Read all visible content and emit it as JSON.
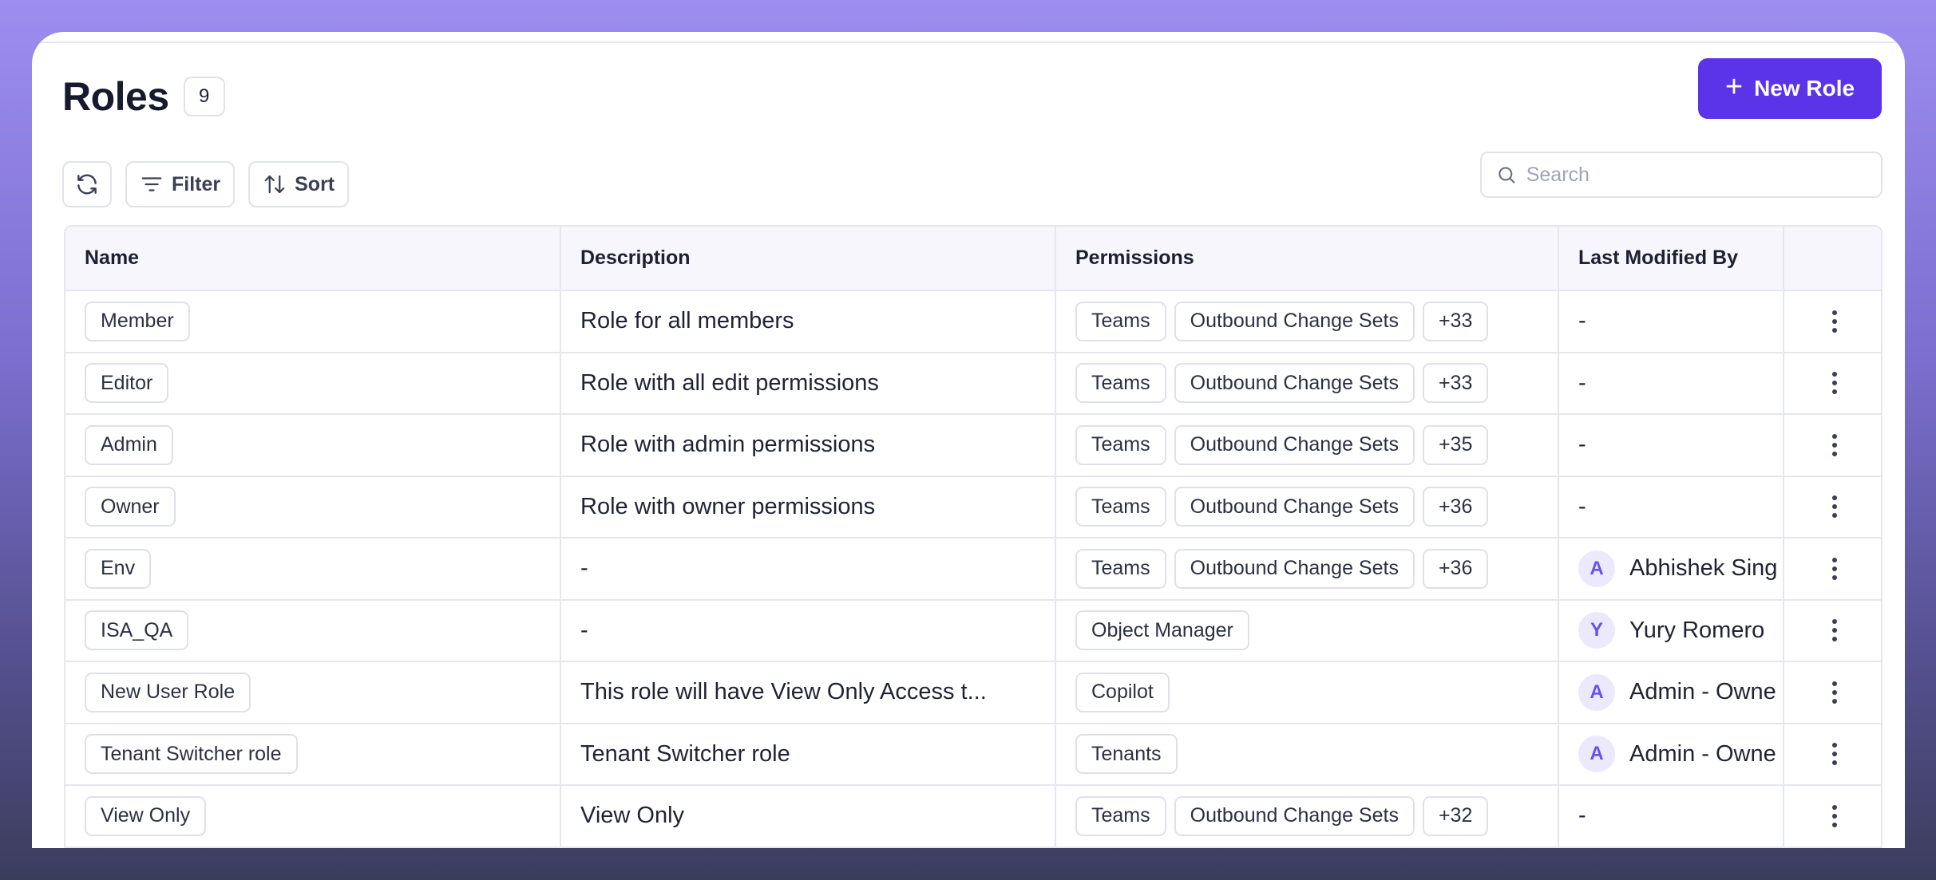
{
  "page": {
    "title": "Roles",
    "count": "9",
    "new_button": "New Role",
    "accent_color": "#5b34ea"
  },
  "toolbar": {
    "refresh_icon": "refresh-icon",
    "filter_label": "Filter",
    "sort_label": "Sort"
  },
  "search": {
    "placeholder": "Search",
    "value": ""
  },
  "table": {
    "columns": [
      "Name",
      "Description",
      "Permissions",
      "Last Modified By",
      ""
    ],
    "rows": [
      {
        "name": "Member",
        "description": "Role for all members",
        "permissions": [
          "Teams",
          "Outbound Change Sets",
          "+33"
        ],
        "modified_by": "-",
        "avatar": ""
      },
      {
        "name": "Editor",
        "description": "Role with all edit permissions",
        "permissions": [
          "Teams",
          "Outbound Change Sets",
          "+33"
        ],
        "modified_by": "-",
        "avatar": ""
      },
      {
        "name": "Admin",
        "description": "Role with admin permissions",
        "permissions": [
          "Teams",
          "Outbound Change Sets",
          "+35"
        ],
        "modified_by": "-",
        "avatar": ""
      },
      {
        "name": "Owner",
        "description": "Role with owner permissions",
        "permissions": [
          "Teams",
          "Outbound Change Sets",
          "+36"
        ],
        "modified_by": "-",
        "avatar": ""
      },
      {
        "name": "Env",
        "description": "-",
        "permissions": [
          "Teams",
          "Outbound Change Sets",
          "+36"
        ],
        "modified_by": "Abhishek Sing",
        "avatar": "A"
      },
      {
        "name": "ISA_QA",
        "description": "-",
        "permissions": [
          "Object Manager"
        ],
        "modified_by": "Yury Romero",
        "avatar": "Y"
      },
      {
        "name": "New User Role",
        "description": "This role will have View Only Access t...",
        "permissions": [
          "Copilot"
        ],
        "modified_by": "Admin - Owne",
        "avatar": "A"
      },
      {
        "name": "Tenant Switcher role",
        "description": "Tenant Switcher role",
        "permissions": [
          "Tenants"
        ],
        "modified_by": "Admin - Owne",
        "avatar": "A"
      },
      {
        "name": "View Only",
        "description": "View Only",
        "permissions": [
          "Teams",
          "Outbound Change Sets",
          "+32"
        ],
        "modified_by": "-",
        "avatar": ""
      }
    ]
  }
}
